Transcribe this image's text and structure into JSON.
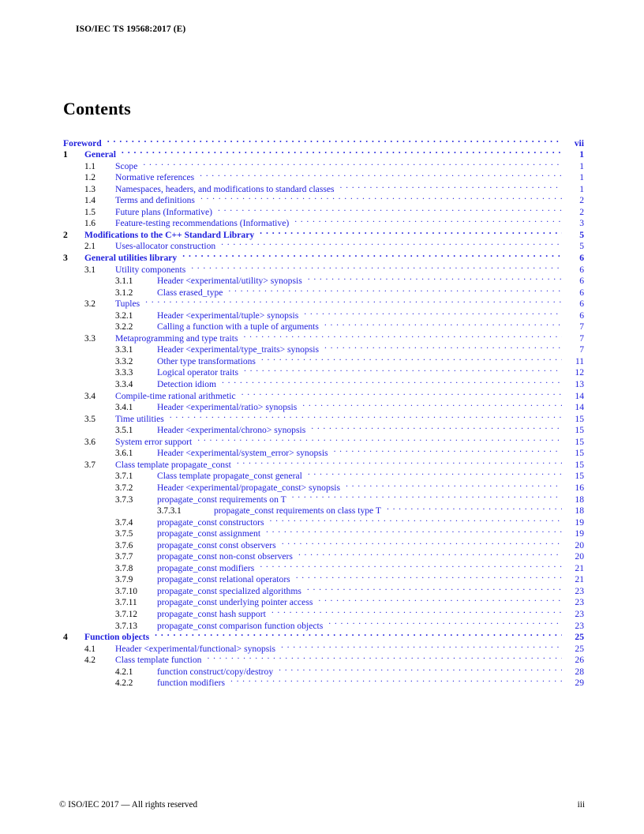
{
  "document": {
    "running_head": "ISO/IEC TS 19568:2017 (E)",
    "contents_heading": "Contents",
    "accent_color": "#2222dd",
    "text_color": "#000000",
    "footer_left": "© ISO/IEC 2017 — All rights reserved",
    "footer_page": "iii"
  },
  "toc": {
    "entries": [
      {
        "level": 0,
        "number": "",
        "title": "Foreword",
        "page": "vii"
      },
      {
        "level": 1,
        "number": "1",
        "title": "General",
        "page": "1"
      },
      {
        "level": 2,
        "number": "1.1",
        "title": "Scope",
        "page": "1"
      },
      {
        "level": 2,
        "number": "1.2",
        "title": "Normative references",
        "page": "1"
      },
      {
        "level": 2,
        "number": "1.3",
        "title": "Namespaces, headers, and modifications to standard classes",
        "page": "1"
      },
      {
        "level": 2,
        "number": "1.4",
        "title": "Terms and definitions",
        "page": "2"
      },
      {
        "level": 2,
        "number": "1.5",
        "title": "Future plans (Informative)",
        "page": "2"
      },
      {
        "level": 2,
        "number": "1.6",
        "title": "Feature-testing recommendations (Informative)",
        "page": "3"
      },
      {
        "level": 1,
        "number": "2",
        "title": "Modifications to the C++ Standard Library",
        "page": "5"
      },
      {
        "level": 2,
        "number": "2.1",
        "title": "Uses-allocator construction",
        "page": "5"
      },
      {
        "level": 1,
        "number": "3",
        "title": "General utilities library",
        "page": "6"
      },
      {
        "level": 2,
        "number": "3.1",
        "title": "Utility components",
        "page": "6"
      },
      {
        "level": 3,
        "number": "3.1.1",
        "title": "Header <experimental/utility> synopsis",
        "page": "6"
      },
      {
        "level": 3,
        "number": "3.1.2",
        "title": "Class erased_type",
        "page": "6"
      },
      {
        "level": 2,
        "number": "3.2",
        "title": "Tuples",
        "page": "6"
      },
      {
        "level": 3,
        "number": "3.2.1",
        "title": "Header <experimental/tuple> synopsis",
        "page": "6"
      },
      {
        "level": 3,
        "number": "3.2.2",
        "title": "Calling a function with a tuple of arguments",
        "page": "7"
      },
      {
        "level": 2,
        "number": "3.3",
        "title": "Metaprogramming and type traits",
        "page": "7"
      },
      {
        "level": 3,
        "number": "3.3.1",
        "title": "Header <experimental/type_traits> synopsis",
        "page": "7"
      },
      {
        "level": 3,
        "number": "3.3.2",
        "title": "Other type transformations",
        "page": "11"
      },
      {
        "level": 3,
        "number": "3.3.3",
        "title": "Logical operator traits",
        "page": "12"
      },
      {
        "level": 3,
        "number": "3.3.4",
        "title": "Detection idiom",
        "page": "13"
      },
      {
        "level": 2,
        "number": "3.4",
        "title": "Compile-time rational arithmetic",
        "page": "14"
      },
      {
        "level": 3,
        "number": "3.4.1",
        "title": "Header <experimental/ratio> synopsis",
        "page": "14"
      },
      {
        "level": 2,
        "number": "3.5",
        "title": "Time utilities",
        "page": "15"
      },
      {
        "level": 3,
        "number": "3.5.1",
        "title": "Header <experimental/chrono> synopsis",
        "page": "15"
      },
      {
        "level": 2,
        "number": "3.6",
        "title": "System error support",
        "page": "15"
      },
      {
        "level": 3,
        "number": "3.6.1",
        "title": "Header <experimental/system_error> synopsis",
        "page": "15"
      },
      {
        "level": 2,
        "number": "3.7",
        "title": "Class template propagate_const",
        "page": "15"
      },
      {
        "level": 3,
        "number": "3.7.1",
        "title": "Class template propagate_const general",
        "page": "15"
      },
      {
        "level": 3,
        "number": "3.7.2",
        "title": "Header <experimental/propagate_const> synopsis",
        "page": "16"
      },
      {
        "level": 3,
        "number": "3.7.3",
        "title": "propagate_const requirements on T",
        "page": "18"
      },
      {
        "level": 4,
        "number": "3.7.3.1",
        "title": "propagate_const requirements on class type T",
        "page": "18"
      },
      {
        "level": 3,
        "number": "3.7.4",
        "title": "propagate_const constructors",
        "page": "19"
      },
      {
        "level": 3,
        "number": "3.7.5",
        "title": "propagate_const assignment",
        "page": "19"
      },
      {
        "level": 3,
        "number": "3.7.6",
        "title": "propagate_const const observers",
        "page": "20"
      },
      {
        "level": 3,
        "number": "3.7.7",
        "title": "propagate_const non-const observers",
        "page": "20"
      },
      {
        "level": 3,
        "number": "3.7.8",
        "title": "propagate_const modifiers",
        "page": "21"
      },
      {
        "level": 3,
        "number": "3.7.9",
        "title": "propagate_const relational operators",
        "page": "21"
      },
      {
        "level": 3,
        "number": "3.7.10",
        "title": "propagate_const specialized algorithms",
        "page": "23"
      },
      {
        "level": 3,
        "number": "3.7.11",
        "title": "propagate_const underlying pointer access",
        "page": "23"
      },
      {
        "level": 3,
        "number": "3.7.12",
        "title": "propagate_const hash support",
        "page": "23"
      },
      {
        "level": 3,
        "number": "3.7.13",
        "title": "propagate_const comparison function objects",
        "page": "23"
      },
      {
        "level": 1,
        "number": "4",
        "title": "Function objects",
        "page": "25"
      },
      {
        "level": 2,
        "number": "4.1",
        "title": "Header <experimental/functional> synopsis",
        "page": "25"
      },
      {
        "level": 2,
        "number": "4.2",
        "title": "Class template function",
        "page": "26"
      },
      {
        "level": 3,
        "number": "4.2.1",
        "title": "function construct/copy/destroy",
        "page": "28"
      },
      {
        "level": 3,
        "number": "4.2.2",
        "title": "function modifiers",
        "page": "29"
      }
    ]
  }
}
